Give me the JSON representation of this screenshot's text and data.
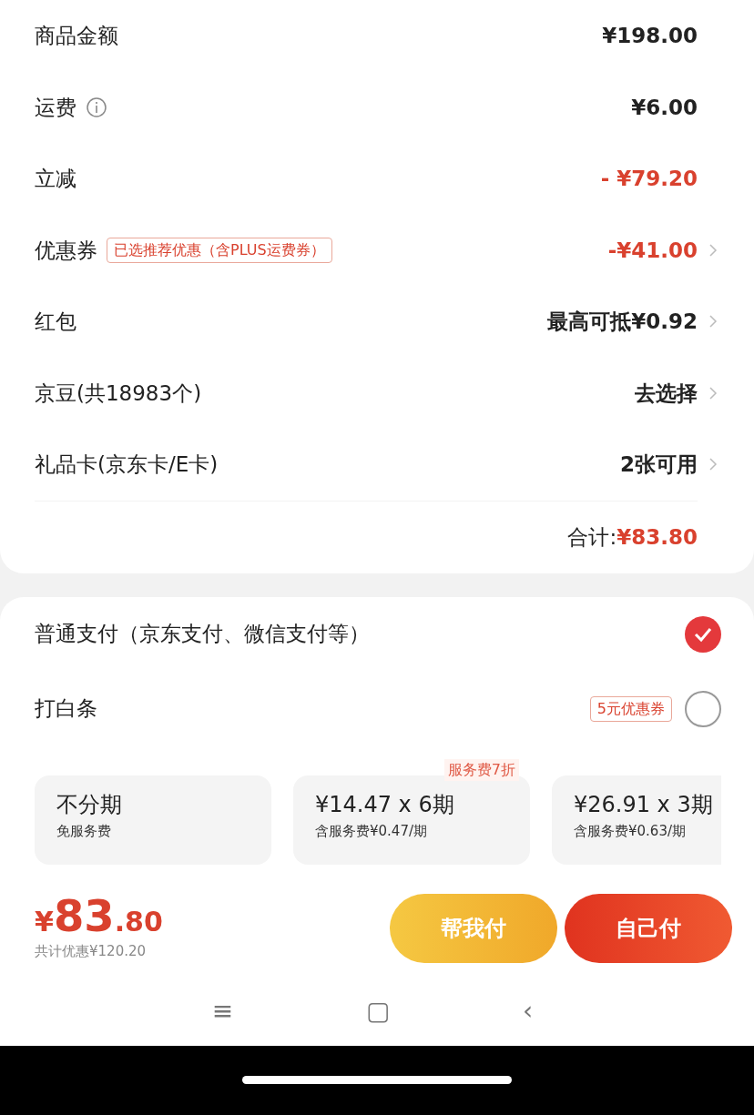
{
  "price_rows": [
    {
      "label": "商品金额",
      "value": "¥198.00",
      "discount": false,
      "info": false,
      "chevron": false
    },
    {
      "label": "运费",
      "value": "¥6.00",
      "discount": false,
      "info": true,
      "chevron": false
    },
    {
      "label": "立减",
      "value": "- ¥79.20",
      "discount": true,
      "info": false,
      "chevron": false
    },
    {
      "label": "优惠券",
      "tag": "已选推荐优惠（含PLUS运费券）",
      "value": "-¥41.00",
      "discount": true,
      "info": false,
      "chevron": true
    },
    {
      "label": "红包",
      "value": "最高可抵¥0.92",
      "discount": false,
      "info": false,
      "chevron": true
    },
    {
      "label": "京豆(共18983个)",
      "value": "去选择",
      "discount": false,
      "info": false,
      "chevron": true
    },
    {
      "label": "礼品卡(京东卡/E卡)",
      "value": "2张可用",
      "discount": false,
      "info": false,
      "chevron": true
    }
  ],
  "total": {
    "label": "合计:",
    "value": "¥83.80"
  },
  "payment_methods": [
    {
      "label": "普通支付（京东支付、微信支付等）",
      "selected": true
    },
    {
      "label": "打白条",
      "tag": "5元优惠券",
      "selected": false
    }
  ],
  "installments": [
    {
      "title": "不分期",
      "note": "免服务费"
    },
    {
      "title": "¥14.47 x 6期",
      "note": "含服务费¥0.47/期",
      "badge": "服务费7折"
    },
    {
      "title": "¥26.91 x 3期",
      "note": "含服务费¥0.63/期"
    }
  ],
  "footer": {
    "currency": "¥",
    "amount_int": "83",
    "amount_dec": ".80",
    "saving": "共计优惠¥120.20",
    "buttons": [
      {
        "label": "帮我付",
        "kind": "secondary"
      },
      {
        "label": "自己付",
        "kind": "primary"
      }
    ]
  },
  "nav_bar": [
    "≡",
    "▢",
    "‹"
  ]
}
